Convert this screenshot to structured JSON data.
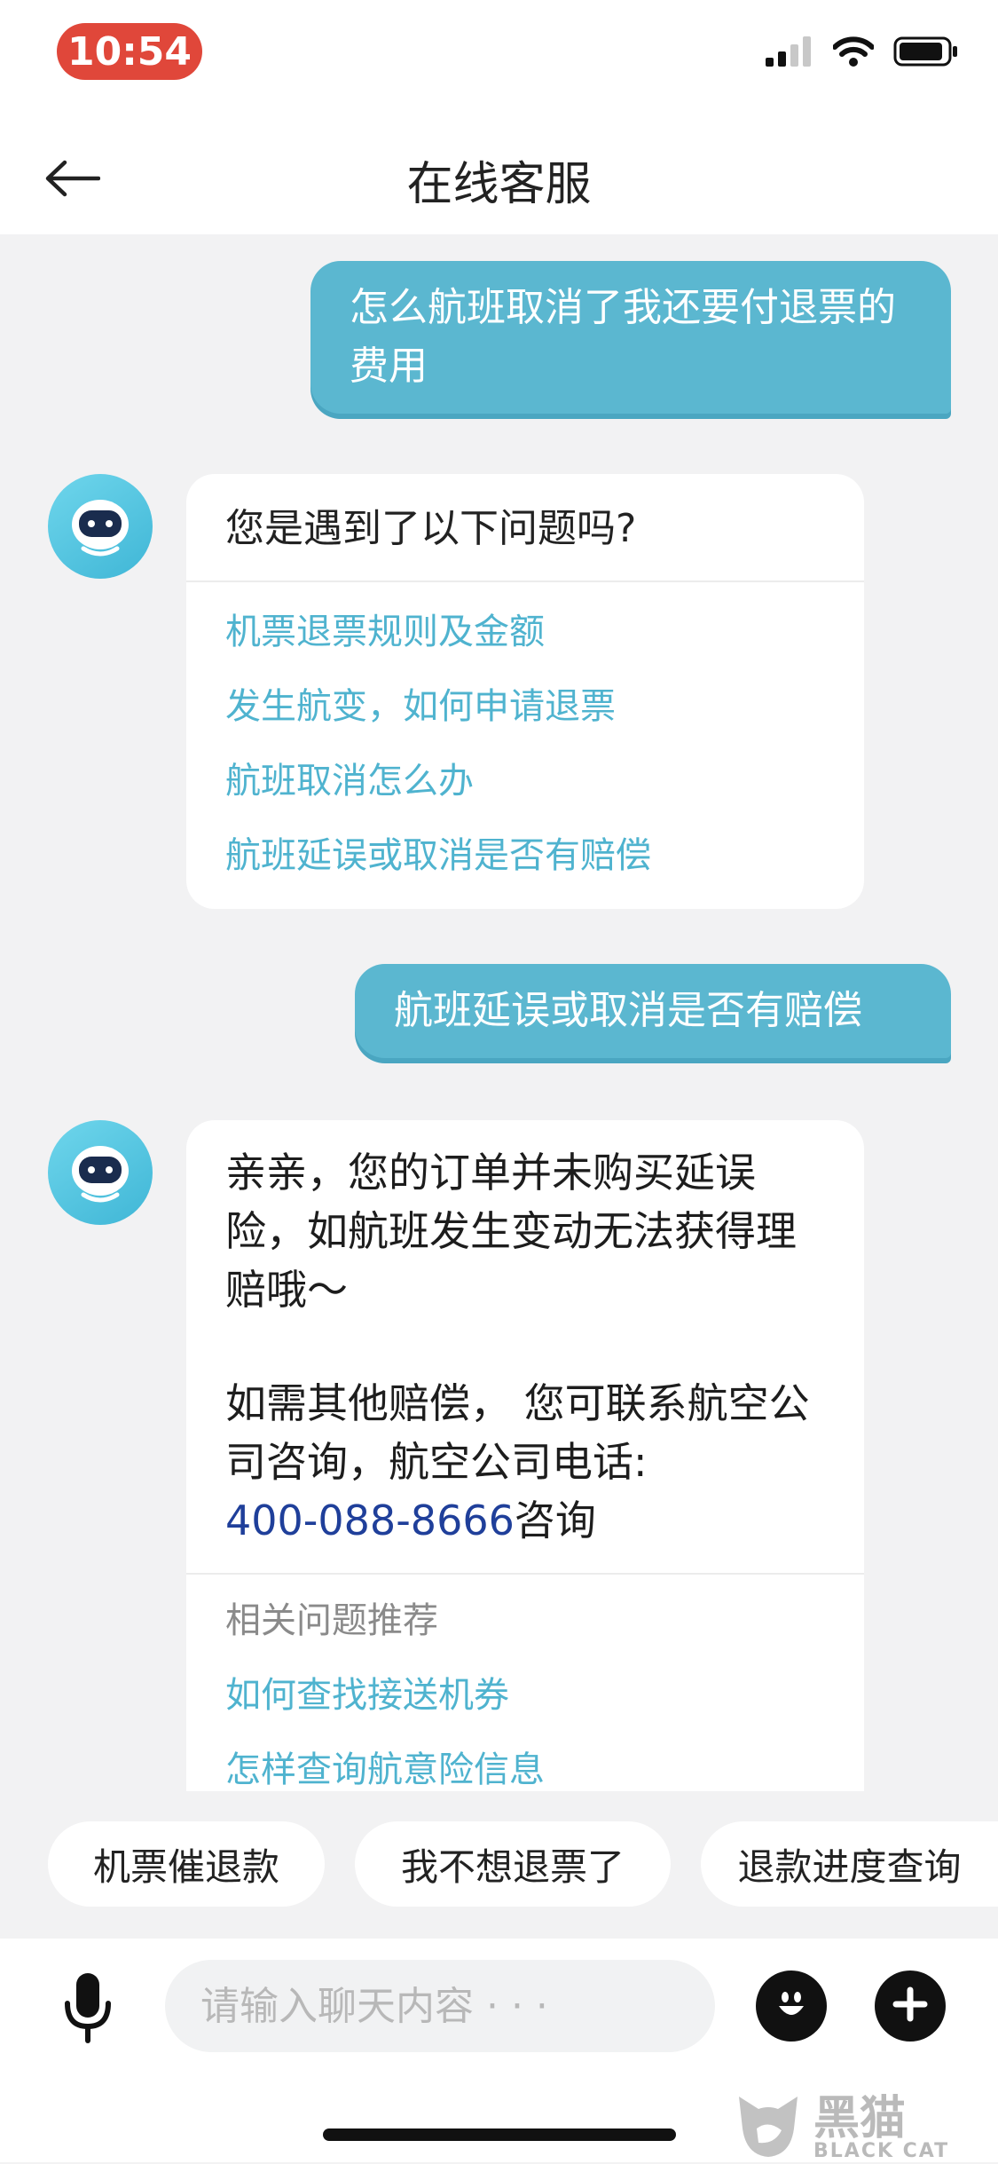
{
  "status_bar": {
    "time": "10:54"
  },
  "header": {
    "title": "在线客服"
  },
  "conversation": {
    "user_message_1": "怎么航班取消了我还要付退票的费用",
    "bot_card_1": {
      "question": "您是遇到了以下问题吗?",
      "options": [
        "机票退票规则及金额",
        "发生航变，如何申请退票",
        "航班取消怎么办",
        "航班延误或取消是否有赔偿"
      ]
    },
    "user_message_2": "航班延误或取消是否有赔偿",
    "bot_card_2": {
      "paragraph_1": "亲亲，您的订单并未购买延误险，如航班发生变动无法获得理赔哦～",
      "paragraph_2": "如需其他赔偿， 您可联系航空公司咨询，航空公司电话:",
      "phone": "400-088-8666",
      "phone_suffix": "咨询",
      "related_title": "相关问题推荐",
      "related": [
        "如何查找接送机券",
        "怎样查询航意险信息"
      ]
    }
  },
  "quick_replies": [
    "机票催退款",
    "我不想退票了",
    "退款进度查询"
  ],
  "input": {
    "placeholder": "请输入聊天内容 · · ·"
  },
  "watermark": {
    "text_cn": "黑猫",
    "text_en": "BLACK CAT"
  },
  "colors": {
    "accent": "#5bb7d0",
    "link": "#4fb3cf",
    "phone": "#1f3f9a",
    "time_pill": "#e0473a"
  }
}
